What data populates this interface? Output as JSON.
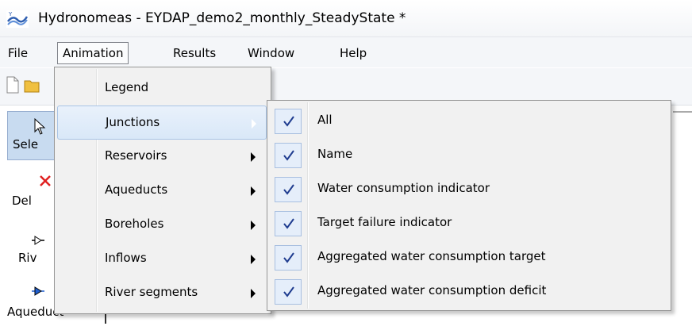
{
  "window": {
    "title": "Hydronomeas - EYDAP_demo2_monthly_SteadyState *"
  },
  "menubar": [
    {
      "label": "File",
      "active": false
    },
    {
      "label": "Animation",
      "active": true
    },
    {
      "label": "Results",
      "active": false
    },
    {
      "label": "Window",
      "active": false
    },
    {
      "label": "Help",
      "active": false
    }
  ],
  "tools": [
    {
      "label": "Sele",
      "icon": "pointer-icon"
    },
    {
      "label": "Del",
      "icon": "delete-icon"
    },
    {
      "label": "Riv",
      "icon": "river-node-icon"
    },
    {
      "label": "Aqueduct",
      "icon": "aqueduct-icon"
    }
  ],
  "animation_menu": {
    "items": [
      {
        "label": "Legend",
        "has_submenu": false
      },
      {
        "label": "Junctions",
        "has_submenu": true,
        "highlighted": true
      },
      {
        "label": "Reservoirs",
        "has_submenu": true
      },
      {
        "label": "Aqueducts",
        "has_submenu": true
      },
      {
        "label": "Boreholes",
        "has_submenu": true
      },
      {
        "label": "Inflows",
        "has_submenu": true
      },
      {
        "label": "River segments",
        "has_submenu": true
      }
    ]
  },
  "junctions_submenu": {
    "items": [
      {
        "label": "All",
        "checked": true
      },
      {
        "label": "Name",
        "checked": true
      },
      {
        "label": "Water consumption indicator",
        "checked": true
      },
      {
        "label": "Target failure indicator",
        "checked": true
      },
      {
        "label": "Aggregated water consumption target",
        "checked": true
      },
      {
        "label": "Aggregated water consumption deficit",
        "checked": true
      }
    ]
  },
  "colors": {
    "highlight": "#d9e8f8",
    "check": "#1f3c8f",
    "menu_bg": "#f1f1f1"
  }
}
